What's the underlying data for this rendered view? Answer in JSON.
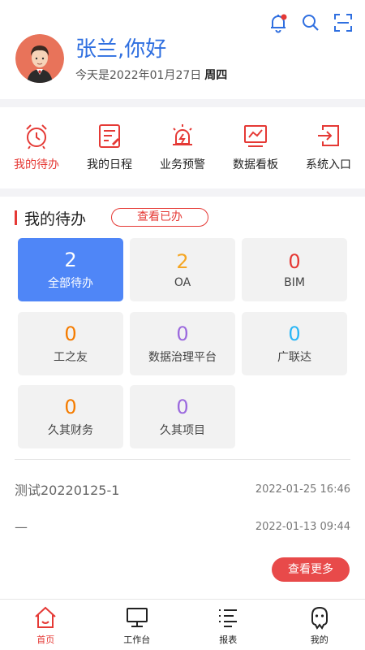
{
  "header": {
    "greeting": "张兰,你好",
    "date_prefix": "今天是2022年01月27日",
    "weekday": "周四"
  },
  "quick_nav": [
    {
      "label": "我的待办",
      "icon": "alarm-clock-icon",
      "active": true
    },
    {
      "label": "我的日程",
      "icon": "schedule-icon",
      "active": false
    },
    {
      "label": "业务预警",
      "icon": "warning-icon",
      "active": false
    },
    {
      "label": "数据看板",
      "icon": "chart-board-icon",
      "active": false
    },
    {
      "label": "系统入口",
      "icon": "system-entry-icon",
      "active": false
    }
  ],
  "todo": {
    "title": "我的待办",
    "view_done_label": "查看已办",
    "tiles": [
      {
        "count": "2",
        "label": "全部待办",
        "color": "#ffffff"
      },
      {
        "count": "2",
        "label": "OA",
        "color": "#f5a623"
      },
      {
        "count": "0",
        "label": "BIM",
        "color": "#e53935"
      },
      {
        "count": "0",
        "label": "工之友",
        "color": "#f57c00"
      },
      {
        "count": "0",
        "label": "数据治理平台",
        "color": "#9c6ade"
      },
      {
        "count": "0",
        "label": "广联达",
        "color": "#29b6f6"
      },
      {
        "count": "0",
        "label": "久其财务",
        "color": "#f57c00"
      },
      {
        "count": "0",
        "label": "久其项目",
        "color": "#9c6ade"
      }
    ]
  },
  "list": [
    {
      "title": "测试20220125-1",
      "time": "2022-01-25 16:46"
    },
    {
      "title": "—",
      "time": "2022-01-13 09:44"
    }
  ],
  "more_label": "查看更多",
  "tabbar": [
    {
      "label": "首页",
      "icon": "home-icon",
      "active": true
    },
    {
      "label": "工作台",
      "icon": "monitor-icon",
      "active": false
    },
    {
      "label": "报表",
      "icon": "report-list-icon",
      "active": false
    },
    {
      "label": "我的",
      "icon": "profile-icon",
      "active": false
    }
  ],
  "colors": {
    "accent": "#e53935",
    "primary_blue": "#4f86f7",
    "greeting_blue": "#2f6fe0"
  }
}
